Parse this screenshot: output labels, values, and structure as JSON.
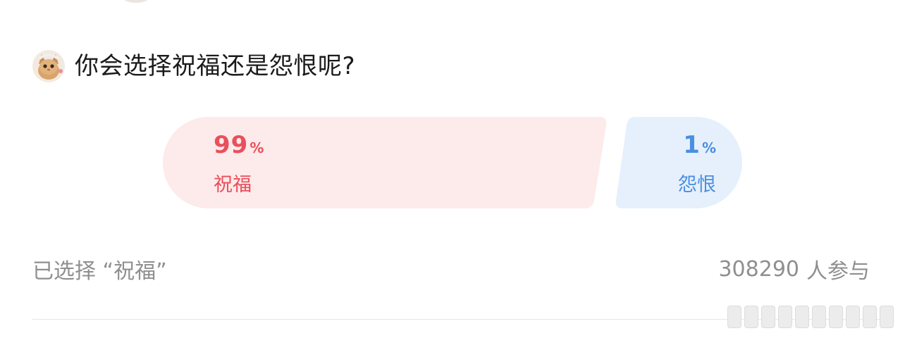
{
  "poll": {
    "question": "你会选择祝福还是怨恨呢?",
    "options": [
      {
        "label": "祝福",
        "percent": "99",
        "percent_sign": "%",
        "color": "#e8505b",
        "fill": "#fdeaea"
      },
      {
        "label": "怨恨",
        "percent": "1",
        "percent_sign": "%",
        "color": "#4a8fe0",
        "fill": "#e6f0fc"
      }
    ],
    "selected_text": "已选择 “祝福”",
    "participants": "308290",
    "participants_suffix": "人参与"
  },
  "icons": {
    "question": "cat-emoji-icon",
    "top": "avatar"
  }
}
